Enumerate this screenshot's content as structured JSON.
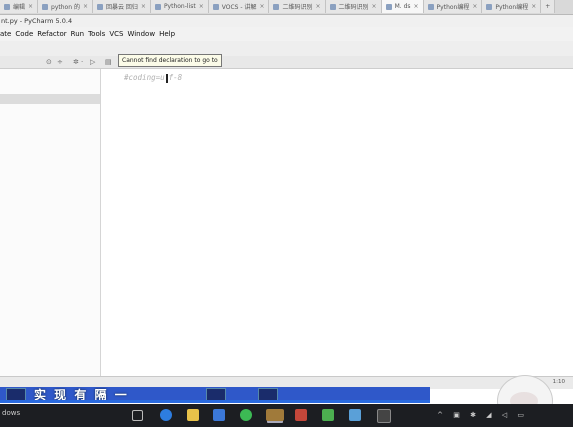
{
  "tabs": [
    {
      "label": "编辑",
      "active": false
    },
    {
      "label": "python 的",
      "active": false
    },
    {
      "label": "回暴云 回归",
      "active": false
    },
    {
      "label": "Python-list",
      "active": false
    },
    {
      "label": "VOCS - 讲解",
      "active": false
    },
    {
      "label": "二维码识别",
      "active": false
    },
    {
      "label": "二维码识别",
      "active": false
    },
    {
      "label": "M. ds",
      "active": true
    },
    {
      "label": "Python编程",
      "active": false
    },
    {
      "label": "Python编程",
      "active": false
    }
  ],
  "new_tab": "+",
  "window_title": "nt.py - PyCharm 5.0.4",
  "menu": [
    "ate",
    "Code",
    "Refactor",
    "Run",
    "Tools",
    "VCS",
    "Window",
    "Help"
  ],
  "tooltip": "Cannot find declaration to go to",
  "code_line": {
    "before": "#coding=u",
    "after": "f-8"
  },
  "status_position": "1:10",
  "banner_text": "实  现 有 隔 一",
  "taskbar_label": "dows",
  "tray_icons": "^ ▣ ✱ ◢ ◁ ▭",
  "colors": {
    "banner": "#2f58c9",
    "taskbar": "#1c1e22",
    "tooltip_bg": "#fbfbe8"
  }
}
